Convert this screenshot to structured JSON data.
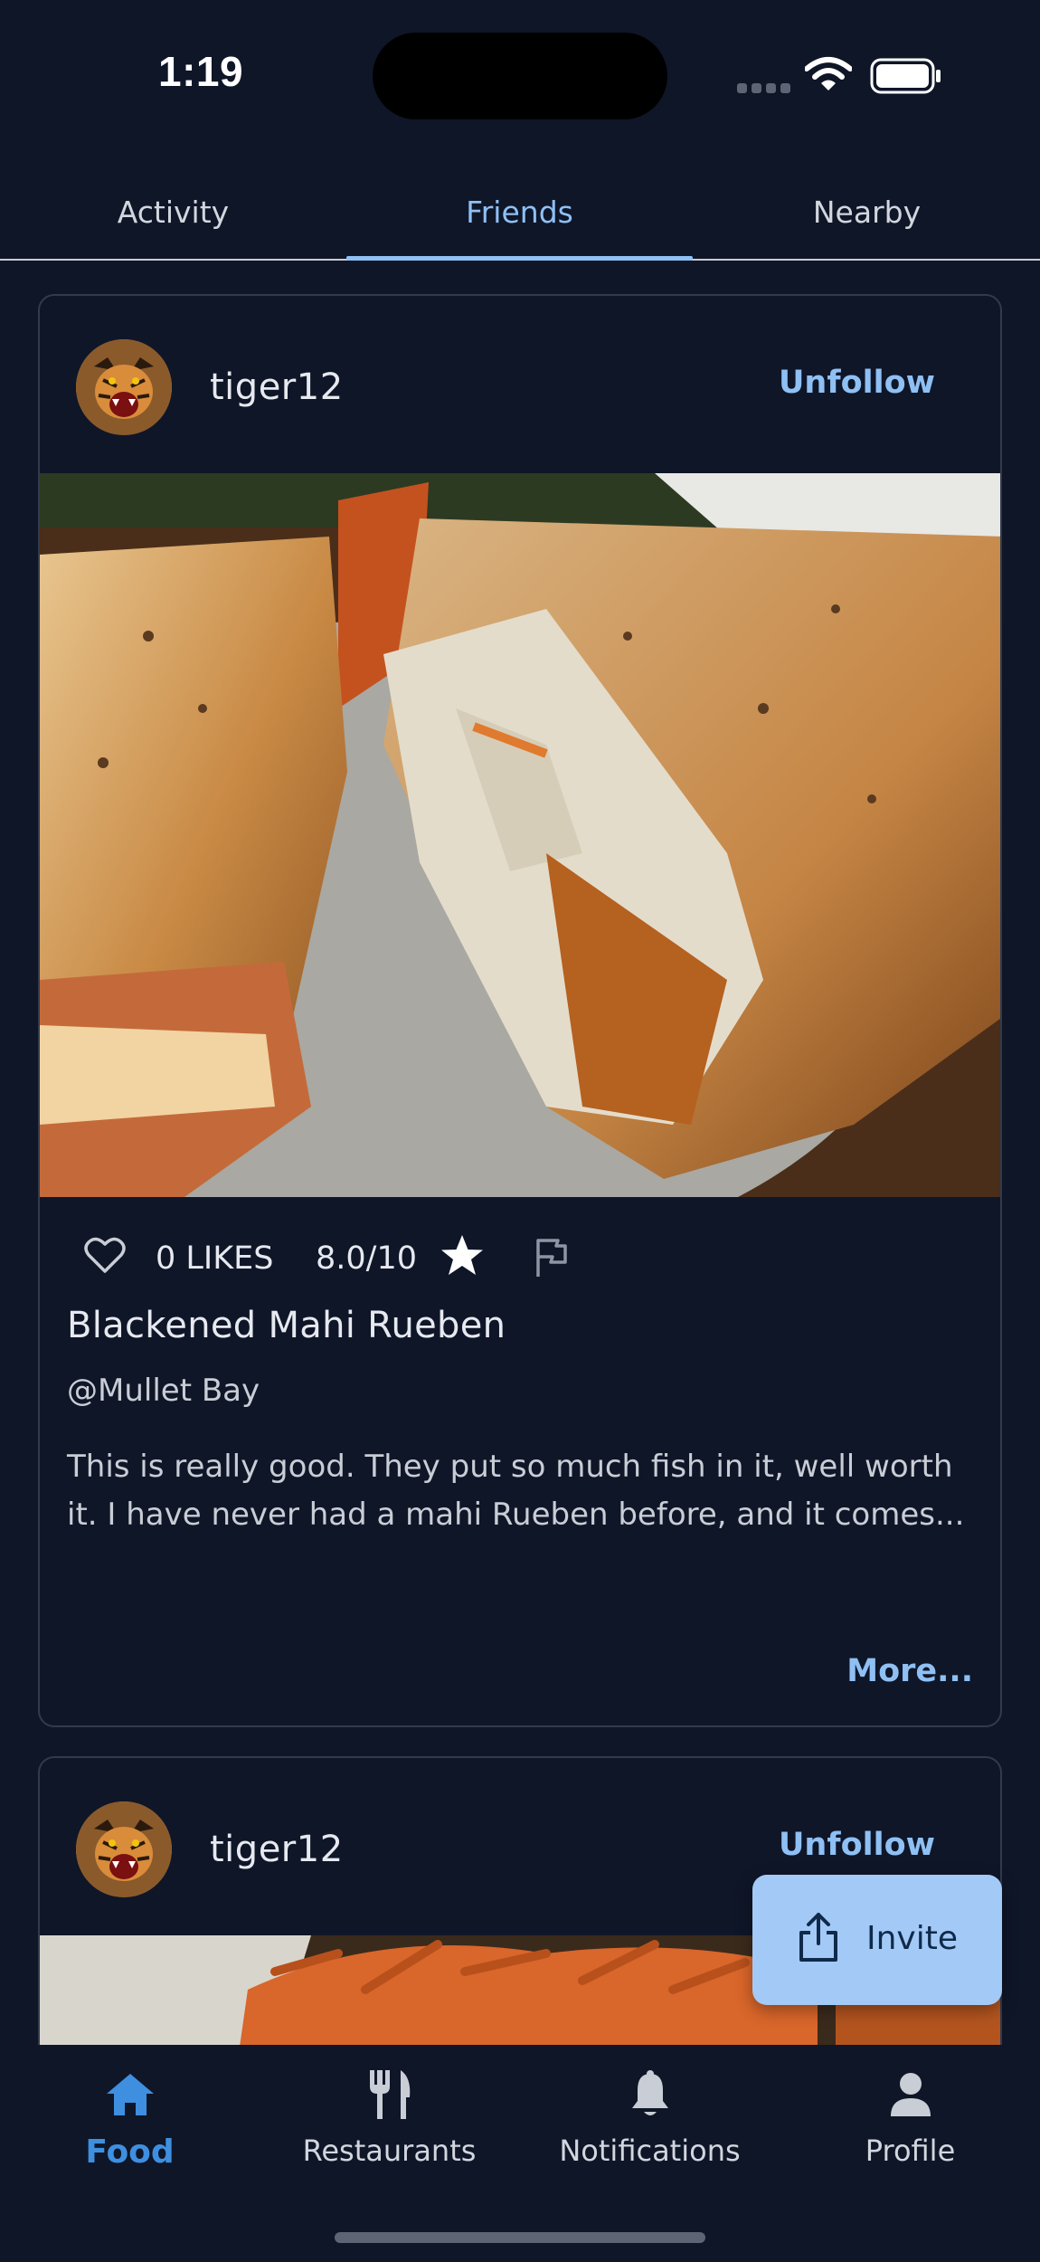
{
  "status_bar": {
    "time": "1:19"
  },
  "top_tabs": [
    {
      "label": "Activity"
    },
    {
      "label": "Friends",
      "active": true
    },
    {
      "label": "Nearby"
    }
  ],
  "posts": [
    {
      "username": "tiger12",
      "follow_label": "Unfollow",
      "likes": "0 LIKES",
      "rating": "8.0/10",
      "dish": "Blackened Mahi Rueben",
      "restaurant": "@Mullet Bay",
      "review": "This is really good. They put so much fish in it, well worth it. I have never had a mahi Rueben before, and it comes...",
      "more_label": "More..."
    },
    {
      "username": "tiger12",
      "follow_label": "Unfollow"
    }
  ],
  "invite_button": {
    "label": "Invite",
    "icon": "share-icon"
  },
  "bottom_nav": [
    {
      "label": "Food",
      "icon": "home-icon",
      "active": true
    },
    {
      "label": "Restaurants",
      "icon": "fork-knife-icon"
    },
    {
      "label": "Notifications",
      "icon": "bell-icon"
    },
    {
      "label": "Profile",
      "icon": "person-icon"
    }
  ],
  "colors": {
    "background": "#0f1628",
    "accent": "#8fc0f4",
    "active_nav": "#3f8fe0",
    "fab": "#a3c9f7"
  }
}
